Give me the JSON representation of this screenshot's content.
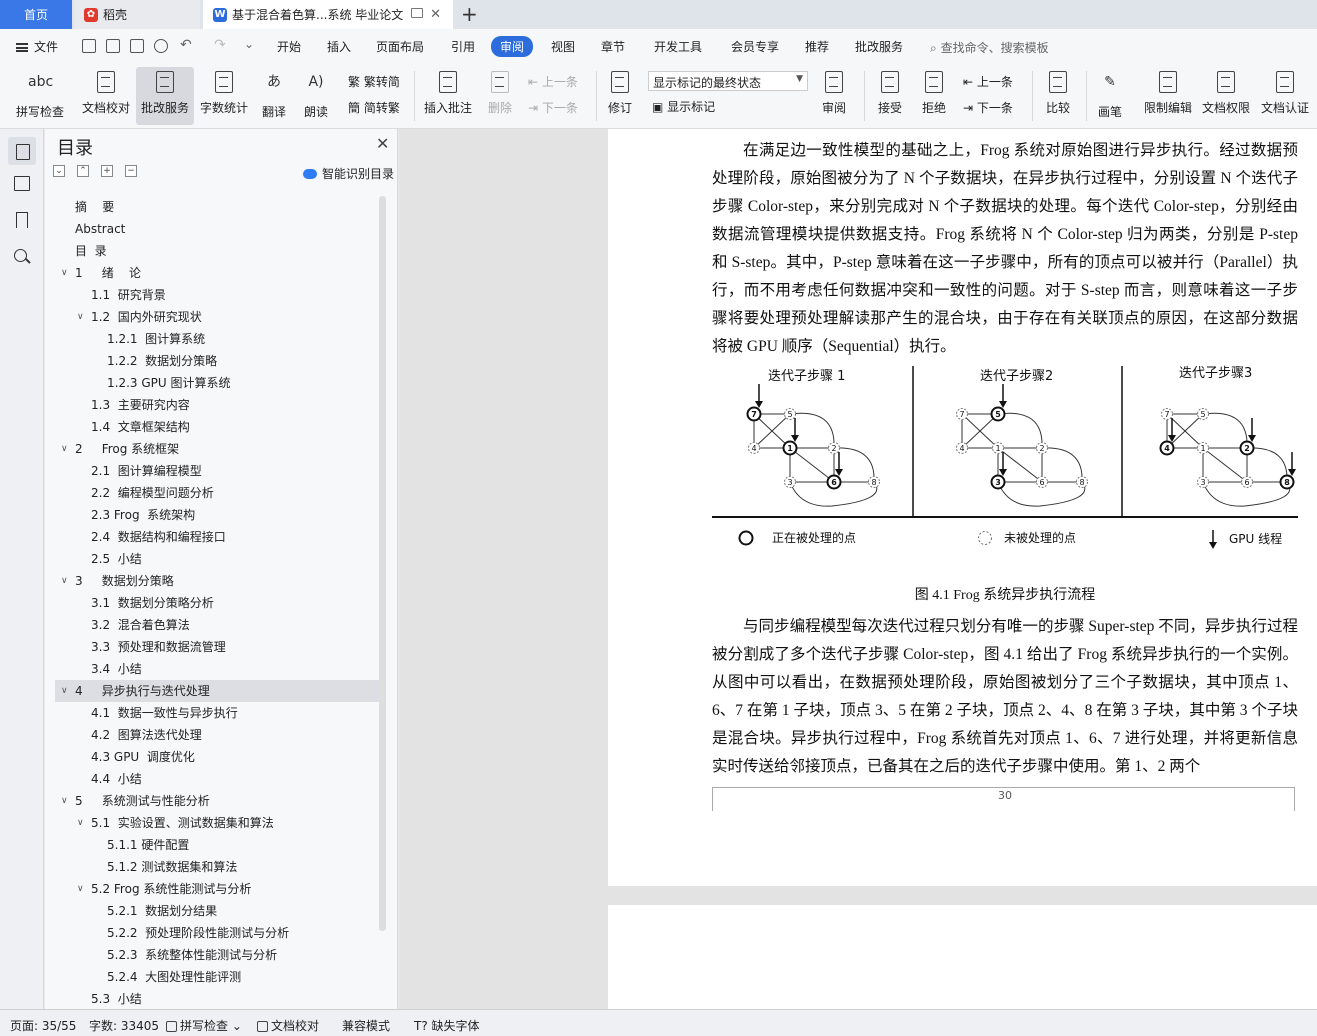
{
  "tabs": {
    "home": "首页",
    "daoke": "稻壳",
    "doc": "基于混合着色算...系统 毕业论文"
  },
  "menu": {
    "file": "文件",
    "items": [
      "开始",
      "插入",
      "页面布局",
      "引用",
      "审阅",
      "视图",
      "章节",
      "开发工具",
      "会员专享",
      "推荐",
      "批改服务"
    ],
    "active": "审阅",
    "search": "查找命令、搜索模板"
  },
  "ribbon": {
    "spell": "拼写检查",
    "proof": "文档校对",
    "correct": "批改服务",
    "wordcount": "字数统计",
    "translate": "翻译",
    "read": "朗读",
    "trad_to_simp": "繁转简",
    "simp_to_trad": "简转繁",
    "insert_comment": "插入批注",
    "delete": "删除",
    "prev": "上一条",
    "next": "下一条",
    "revise": "修订",
    "track_state": "显示标记的最终状态",
    "show_markup": "显示标记",
    "review": "审阅",
    "accept": "接受",
    "reject": "拒绝",
    "prev2": "上一条",
    "next2": "下一条",
    "compare": "比较",
    "pen": "画笔",
    "restrict": "限制编辑",
    "doc_perm": "文档权限",
    "doc_cert": "文档认证",
    "abc": "abc"
  },
  "toc": {
    "title": "目录",
    "smart": "智能识别目录",
    "items": [
      {
        "t": "摘    要",
        "lvl": 0,
        "arrow": ""
      },
      {
        "t": "Abstract",
        "lvl": 0,
        "arrow": ""
      },
      {
        "t": "目  录",
        "lvl": 0,
        "arrow": ""
      },
      {
        "t": "1     绪    论",
        "lvl": 0,
        "arrow": "down"
      },
      {
        "t": "1.1  研究背景",
        "lvl": 1,
        "arrow": ""
      },
      {
        "t": "1.2  国内外研究现状",
        "lvl": 1,
        "arrow": "down"
      },
      {
        "t": "1.2.1  图计算系统",
        "lvl": 2,
        "arrow": ""
      },
      {
        "t": "1.2.2  数据划分策略",
        "lvl": 2,
        "arrow": ""
      },
      {
        "t": "1.2.3 GPU 图计算系统",
        "lvl": 2,
        "arrow": ""
      },
      {
        "t": "1.3  主要研究内容",
        "lvl": 1,
        "arrow": ""
      },
      {
        "t": "1.4  文章框架结构",
        "lvl": 1,
        "arrow": ""
      },
      {
        "t": "2     Frog 系统框架",
        "lvl": 0,
        "arrow": "down"
      },
      {
        "t": "2.1  图计算编程模型",
        "lvl": 1,
        "arrow": ""
      },
      {
        "t": "2.2  编程模型问题分析",
        "lvl": 1,
        "arrow": ""
      },
      {
        "t": "2.3 Frog  系统架构",
        "lvl": 1,
        "arrow": ""
      },
      {
        "t": "2.4  数据结构和编程接口",
        "lvl": 1,
        "arrow": ""
      },
      {
        "t": "2.5  小结",
        "lvl": 1,
        "arrow": ""
      },
      {
        "t": "3     数据划分策略",
        "lvl": 0,
        "arrow": "down"
      },
      {
        "t": "3.1  数据划分策略分析",
        "lvl": 1,
        "arrow": ""
      },
      {
        "t": "3.2  混合着色算法",
        "lvl": 1,
        "arrow": ""
      },
      {
        "t": "3.3  预处理和数据流管理",
        "lvl": 1,
        "arrow": ""
      },
      {
        "t": "3.4  小结",
        "lvl": 1,
        "arrow": ""
      },
      {
        "t": "4     异步执行与迭代处理",
        "lvl": 0,
        "arrow": "down",
        "active": true
      },
      {
        "t": "4.1  数据一致性与异步执行",
        "lvl": 1,
        "arrow": ""
      },
      {
        "t": "4.2  图算法迭代处理",
        "lvl": 1,
        "arrow": ""
      },
      {
        "t": "4.3 GPU  调度优化",
        "lvl": 1,
        "arrow": ""
      },
      {
        "t": "4.4  小结",
        "lvl": 1,
        "arrow": ""
      },
      {
        "t": "5     系统测试与性能分析",
        "lvl": 0,
        "arrow": "down"
      },
      {
        "t": "5.1  实验设置、测试数据集和算法",
        "lvl": 1,
        "arrow": "down"
      },
      {
        "t": "5.1.1 硬件配置",
        "lvl": 2,
        "arrow": ""
      },
      {
        "t": "5.1.2 测试数据集和算法",
        "lvl": 2,
        "arrow": ""
      },
      {
        "t": "5.2 Frog 系统性能测试与分析",
        "lvl": 1,
        "arrow": "down"
      },
      {
        "t": "5.2.1  数据划分结果",
        "lvl": 2,
        "arrow": ""
      },
      {
        "t": "5.2.2  预处理阶段性能测试与分析",
        "lvl": 2,
        "arrow": ""
      },
      {
        "t": "5.2.3  系统整体性能测试与分析",
        "lvl": 2,
        "arrow": ""
      },
      {
        "t": "5.2.4  大图处理性能评测",
        "lvl": 2,
        "arrow": ""
      },
      {
        "t": "5.3  小结",
        "lvl": 1,
        "arrow": ""
      }
    ]
  },
  "doc": {
    "para1": "在满足边一致性模型的基础之上，Frog 系统对原始图进行异步执行。经过数据预处理阶段，原始图被分为了 N 个子数据块，在异步执行过程中，分别设置 N 个迭代子步骤 Color-step，来分别完成对 N 个子数据块的处理。每个迭代 Color-step，分别经由数据流管理模块提供数据支持。Frog 系统将 N 个 Color-step 归为两类，分别是 P-step 和 S-step。其中，P-step 意味着在这一子步骤中，所有的顶点可以被并行（Parallel）执行，而不用考虑任何数据冲突和一致性的问题。对于 S-step 而言，则意味着这一子步骤将要处理预处理解读那产生的混合块，由于存在有关联顶点的原因，在这部分数据将被 GPU 顺序（Sequential）执行。",
    "fig_step1": "迭代子步骤 1",
    "fig_step2": "迭代子步骤2",
    "fig_step3": "迭代子步骤3",
    "legend_processing": "正在被处理的点",
    "legend_unprocessed": "未被处理的点",
    "legend_gpu": "GPU 线程",
    "caption": "图 4.1 Frog 系统异步执行流程",
    "para2": "与同步编程模型每次迭代过程只划分有唯一的步骤 Super-step 不同，异步执行过程被分割成了多个迭代子步骤 Color-step，图 4.1 给出了 Frog 系统异步执行的一个实例。从图中可以看出，在数据预处理阶段，原始图被划分了三个子数据块，其中顶点 1、6、7 在第 1 子块，顶点 3、5 在第 2 子块，顶点 2、4、8 在第 3 子块，其中第 3 个子块是混合块。异步执行过程中，Frog 系统首先对顶点 1、6、7 进行处理，并将更新信息实时传送给邻接顶点，已备其在之后的迭代子步骤中使用。第 1、2 两个",
    "page_number": "30"
  },
  "status": {
    "page": "页面: 35/55",
    "words": "字数: 33405",
    "spell": "拼写检查",
    "proof": "文档校对",
    "compat": "兼容模式",
    "missing_font": "缺失字体"
  }
}
